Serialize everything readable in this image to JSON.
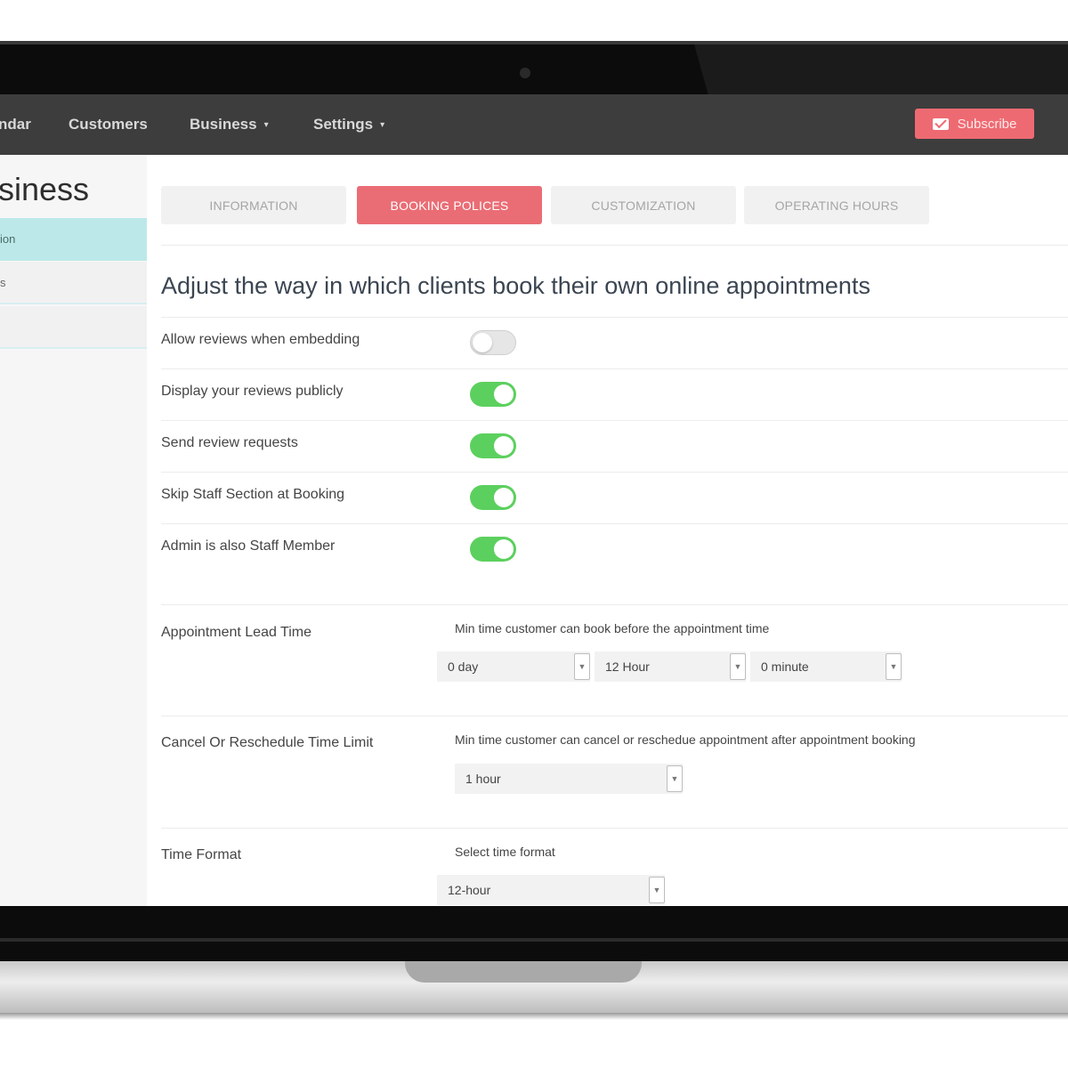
{
  "nav": {
    "items": [
      {
        "label": "ndar",
        "caret": ""
      },
      {
        "label": "Customers",
        "caret": ""
      },
      {
        "label": "Business",
        "caret": "▾"
      },
      {
        "label": "Settings",
        "caret": "▾"
      }
    ],
    "subscribe_label": "Subscribe"
  },
  "sidebar": {
    "title": "siness",
    "items": [
      {
        "label": "ion"
      },
      {
        "label": "s"
      },
      {
        "label": ""
      }
    ]
  },
  "tabs": [
    {
      "label": "INFORMATION"
    },
    {
      "label": "BOOKING POLICES"
    },
    {
      "label": "CUSTOMIZATION"
    },
    {
      "label": "OPERATING HOURS"
    }
  ],
  "active_tab": "BOOKING POLICES",
  "heading": "Adjust the way in which clients book their own online appointments",
  "toggles": [
    {
      "label": "Allow reviews when embedding",
      "on": false
    },
    {
      "label": "Display your reviews publicly",
      "on": true
    },
    {
      "label": "Send review requests",
      "on": true
    },
    {
      "label": "Skip Staff Section at Booking",
      "on": true
    },
    {
      "label": "Admin is also Staff Member",
      "on": true
    }
  ],
  "lead_time": {
    "label": "Appointment Lead Time",
    "help": "Min time customer can book before the appointment time",
    "day": "0 day",
    "hour": "12 Hour",
    "minute": "0 minute"
  },
  "cancel_limit": {
    "label": "Cancel Or Reschedule Time Limit",
    "help": "Min time customer can cancel or reschedue appointment after appointment booking",
    "value": "1 hour"
  },
  "time_format": {
    "label": "Time Format",
    "help": "Select time format",
    "value": "12-hour"
  },
  "icons": {
    "subscribe": "mail-icon",
    "select_arrow": "chevron-down-icon"
  },
  "colors": {
    "accent": "#ea6d75",
    "toggle_on": "#5cd05e",
    "sidebar_active": "#bde8e9",
    "navbar": "#3d3d3d"
  }
}
